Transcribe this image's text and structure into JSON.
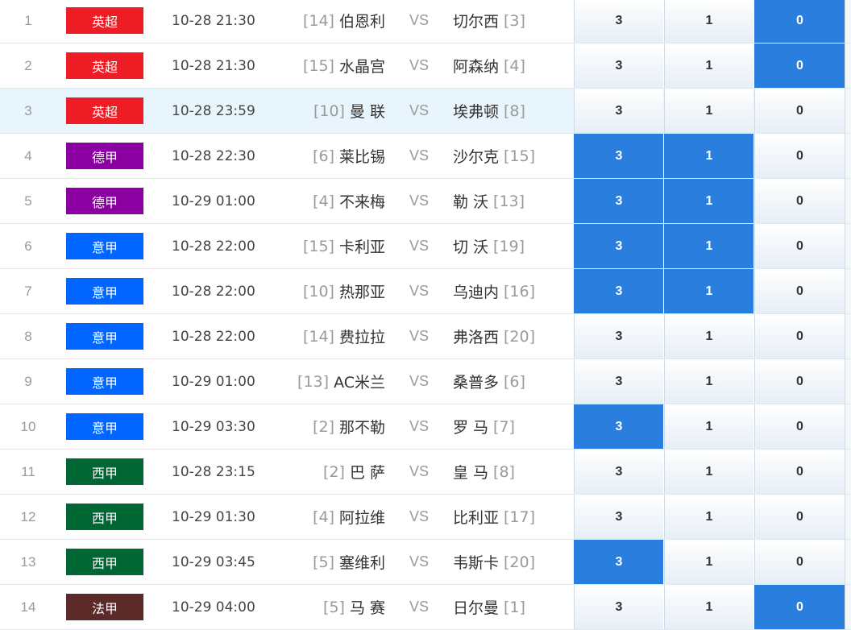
{
  "vs_label": "VS",
  "colors": {
    "英超": "#ee1c25",
    "德甲": "#8b00a0",
    "意甲": "#0066ff",
    "西甲": "#006633",
    "法甲": "#5c2b29",
    "selected_odds": "#2a7fde",
    "row_highlight": "#e9f5fc"
  },
  "matches": [
    {
      "index": "1",
      "league": "英超",
      "time": "10-28 21:30",
      "home_rank": "[14]",
      "home": "伯恩利",
      "away": "切尔西",
      "away_rank": "[3]",
      "odds": [
        "3",
        "1",
        "0"
      ],
      "selected": [
        false,
        false,
        true
      ],
      "highlighted": false
    },
    {
      "index": "2",
      "league": "英超",
      "time": "10-28 21:30",
      "home_rank": "[15]",
      "home": "水晶宫",
      "away": "阿森纳",
      "away_rank": "[4]",
      "odds": [
        "3",
        "1",
        "0"
      ],
      "selected": [
        false,
        false,
        true
      ],
      "highlighted": false
    },
    {
      "index": "3",
      "league": "英超",
      "time": "10-28 23:59",
      "home_rank": "[10]",
      "home": "曼 联",
      "away": "埃弗顿",
      "away_rank": "[8]",
      "odds": [
        "3",
        "1",
        "0"
      ],
      "selected": [
        false,
        false,
        false
      ],
      "highlighted": true
    },
    {
      "index": "4",
      "league": "德甲",
      "time": "10-28 22:30",
      "home_rank": "[6]",
      "home": "莱比锡",
      "away": "沙尔克",
      "away_rank": "[15]",
      "odds": [
        "3",
        "1",
        "0"
      ],
      "selected": [
        true,
        true,
        false
      ],
      "highlighted": false
    },
    {
      "index": "5",
      "league": "德甲",
      "time": "10-29 01:00",
      "home_rank": "[4]",
      "home": "不来梅",
      "away": "勒 沃",
      "away_rank": "[13]",
      "odds": [
        "3",
        "1",
        "0"
      ],
      "selected": [
        true,
        true,
        false
      ],
      "highlighted": false
    },
    {
      "index": "6",
      "league": "意甲",
      "time": "10-28 22:00",
      "home_rank": "[15]",
      "home": "卡利亚",
      "away": "切 沃",
      "away_rank": "[19]",
      "odds": [
        "3",
        "1",
        "0"
      ],
      "selected": [
        true,
        true,
        false
      ],
      "highlighted": false
    },
    {
      "index": "7",
      "league": "意甲",
      "time": "10-28 22:00",
      "home_rank": "[10]",
      "home": "热那亚",
      "away": "乌迪内",
      "away_rank": "[16]",
      "odds": [
        "3",
        "1",
        "0"
      ],
      "selected": [
        true,
        true,
        false
      ],
      "highlighted": false
    },
    {
      "index": "8",
      "league": "意甲",
      "time": "10-28 22:00",
      "home_rank": "[14]",
      "home": "费拉拉",
      "away": "弗洛西",
      "away_rank": "[20]",
      "odds": [
        "3",
        "1",
        "0"
      ],
      "selected": [
        false,
        false,
        false
      ],
      "highlighted": false
    },
    {
      "index": "9",
      "league": "意甲",
      "time": "10-29 01:00",
      "home_rank": "[13]",
      "home": "AC米兰",
      "away": "桑普多",
      "away_rank": "[6]",
      "odds": [
        "3",
        "1",
        "0"
      ],
      "selected": [
        false,
        false,
        false
      ],
      "highlighted": false
    },
    {
      "index": "10",
      "league": "意甲",
      "time": "10-29 03:30",
      "home_rank": "[2]",
      "home": "那不勒",
      "away": "罗 马",
      "away_rank": "[7]",
      "odds": [
        "3",
        "1",
        "0"
      ],
      "selected": [
        true,
        false,
        false
      ],
      "highlighted": false
    },
    {
      "index": "11",
      "league": "西甲",
      "time": "10-28 23:15",
      "home_rank": "[2]",
      "home": "巴 萨",
      "away": "皇 马",
      "away_rank": "[8]",
      "odds": [
        "3",
        "1",
        "0"
      ],
      "selected": [
        false,
        false,
        false
      ],
      "highlighted": false
    },
    {
      "index": "12",
      "league": "西甲",
      "time": "10-29 01:30",
      "home_rank": "[4]",
      "home": "阿拉维",
      "away": "比利亚",
      "away_rank": "[17]",
      "odds": [
        "3",
        "1",
        "0"
      ],
      "selected": [
        false,
        false,
        false
      ],
      "highlighted": false
    },
    {
      "index": "13",
      "league": "西甲",
      "time": "10-29 03:45",
      "home_rank": "[5]",
      "home": "塞维利",
      "away": "韦斯卡",
      "away_rank": "[20]",
      "odds": [
        "3",
        "1",
        "0"
      ],
      "selected": [
        true,
        false,
        false
      ],
      "highlighted": false
    },
    {
      "index": "14",
      "league": "法甲",
      "time": "10-29 04:00",
      "home_rank": "[5]",
      "home": "马 赛",
      "away": "日尔曼",
      "away_rank": "[1]",
      "odds": [
        "3",
        "1",
        "0"
      ],
      "selected": [
        false,
        false,
        true
      ],
      "highlighted": false
    }
  ]
}
